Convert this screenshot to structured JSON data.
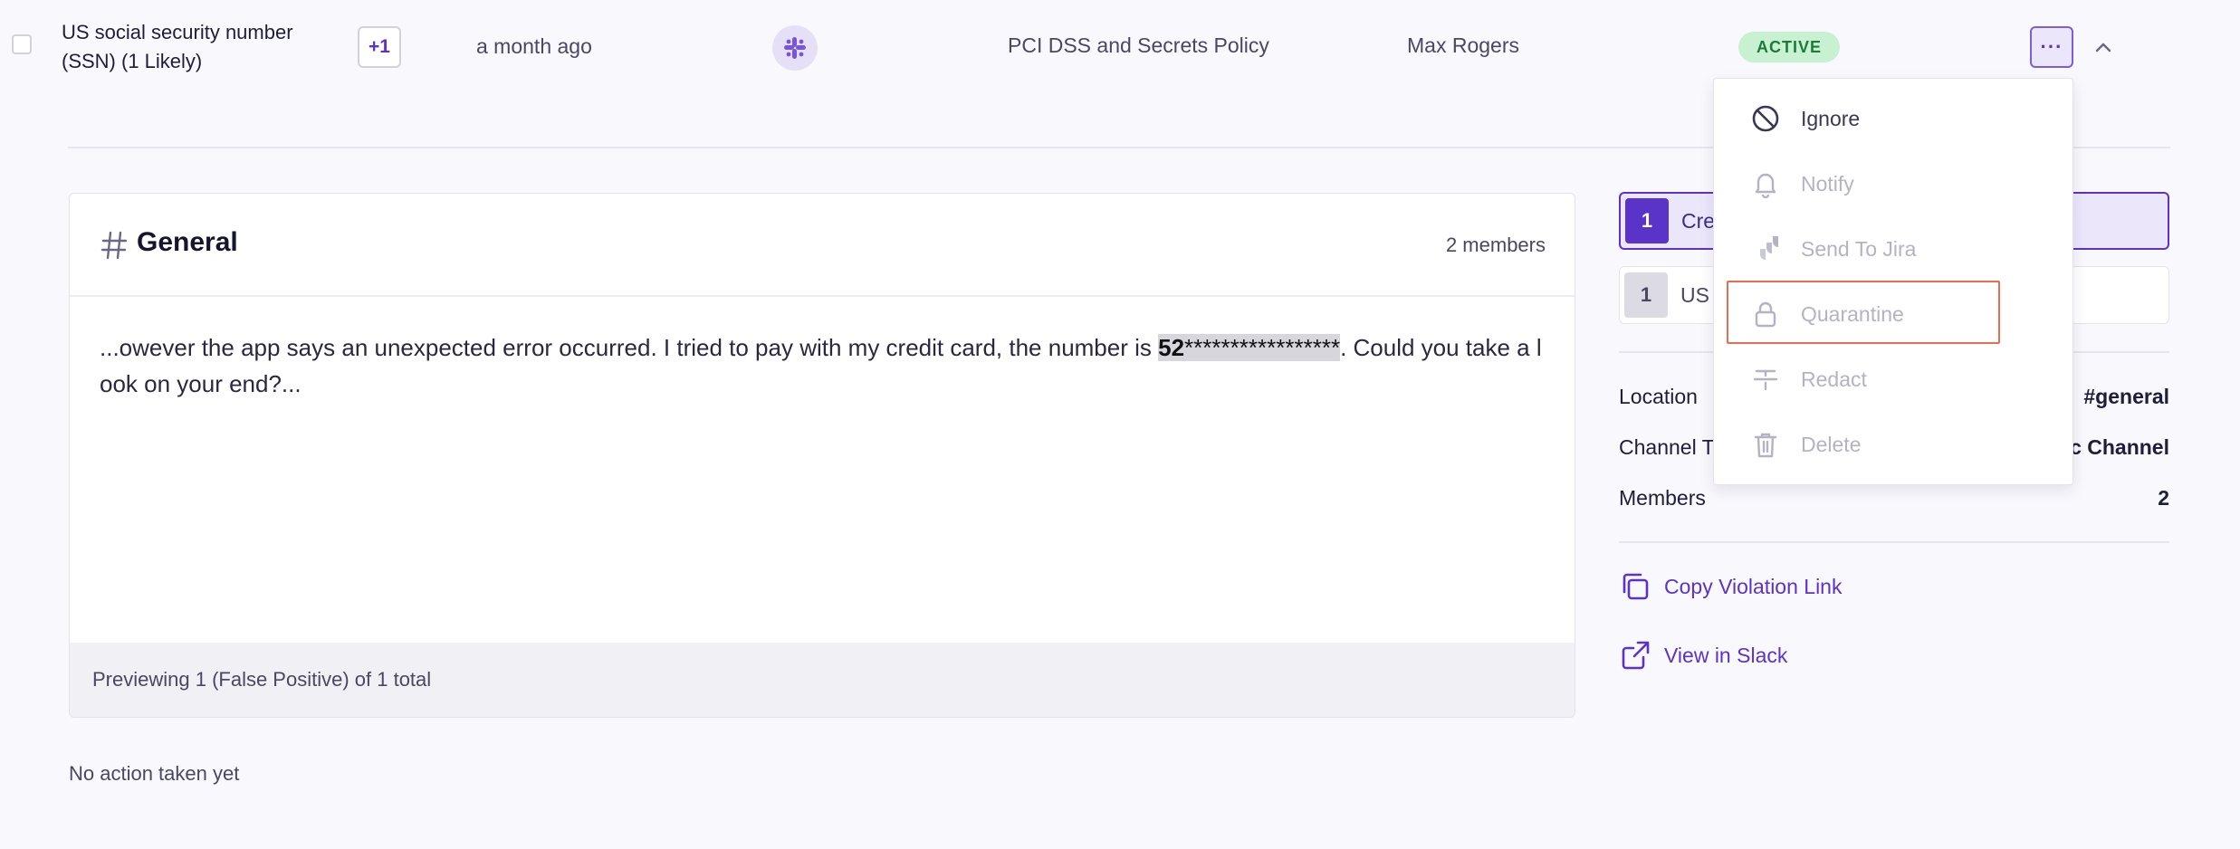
{
  "row": {
    "title": "US social security number (SSN) (1 Likely)",
    "extra_count": "+1",
    "time": "a month ago",
    "policy": "PCI DSS and Secrets Policy",
    "owner": "Max Rogers",
    "status": "ACTIVE",
    "more_label": "···"
  },
  "card": {
    "channel": "General",
    "members": "2 members",
    "text_before": "...owever the app says an unexpected error occurred. I tried to pay with my credit card, the number is ",
    "text_masked_bold": "52",
    "text_masked_rest": "*****************",
    "text_after": ". Could you take a look on your end?...",
    "footer": "Previewing 1 (False Positive) of 1 total"
  },
  "no_action": "No action taken yet",
  "matches": [
    {
      "num": "1",
      "label": "Cre"
    },
    {
      "num": "1",
      "label": "US"
    }
  ],
  "meta": [
    {
      "key": "Location",
      "value": "#general"
    },
    {
      "key": "Channel T",
      "value": "c Channel"
    },
    {
      "key": "Members",
      "value": "2"
    }
  ],
  "links": {
    "copy": "Copy Violation Link",
    "view": "View in Slack"
  },
  "menu": {
    "ignore": "Ignore",
    "notify": "Notify",
    "jira": "Send To Jira",
    "quarantine": "Quarantine",
    "redact": "Redact",
    "delete": "Delete"
  },
  "colors": {
    "accent": "#5a33c9",
    "status_bg": "#c8f1d2",
    "status_fg": "#1e7a3a",
    "focus_outline": "#e96d4f"
  }
}
